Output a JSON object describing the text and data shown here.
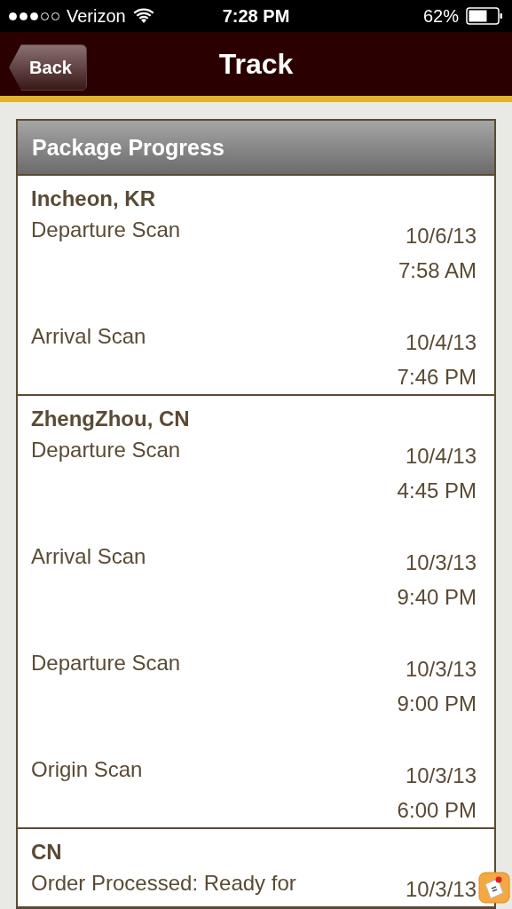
{
  "status_bar": {
    "carrier": "Verizon",
    "time": "7:28 PM",
    "battery": "62%"
  },
  "nav": {
    "back": "Back",
    "title": "Track"
  },
  "panel": {
    "title": "Package Progress",
    "sections": [
      {
        "location": "Incheon, KR",
        "events": [
          {
            "description": "Departure Scan",
            "date": "10/6/13",
            "time": "7:58 AM"
          },
          {
            "description": "Arrival Scan",
            "date": "10/4/13",
            "time": "7:46 PM"
          }
        ]
      },
      {
        "location": "ZhengZhou, CN",
        "events": [
          {
            "description": "Departure Scan",
            "date": "10/4/13",
            "time": "4:45 PM"
          },
          {
            "description": "Arrival Scan",
            "date": "10/3/13",
            "time": "9:40 PM"
          },
          {
            "description": "Departure Scan",
            "date": "10/3/13",
            "time": "9:00 PM"
          },
          {
            "description": "Origin Scan",
            "date": "10/3/13",
            "time": "6:00 PM"
          }
        ]
      },
      {
        "location": "CN",
        "events": [
          {
            "description": "Order Processed: Ready for",
            "date": "10/3/13"
          }
        ]
      }
    ]
  }
}
